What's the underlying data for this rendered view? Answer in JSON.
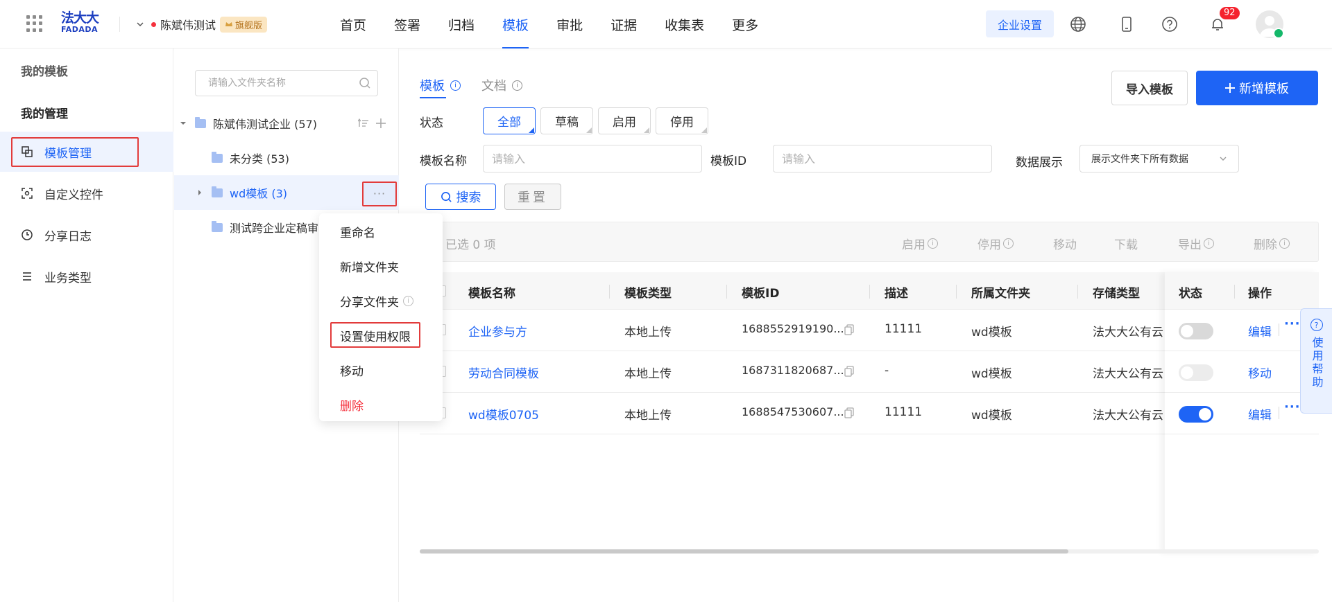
{
  "brand": {
    "logo_cn": "法大大",
    "logo_en": "FADADA"
  },
  "header": {
    "org_name": "陈斌伟测试",
    "edition": "旗舰版",
    "nav": [
      "首页",
      "签署",
      "归档",
      "模板",
      "审批",
      "证据",
      "收集表",
      "更多"
    ],
    "active_nav": "模板",
    "enterprise_settings": "企业设置",
    "notification_count": "92",
    "icons": [
      "apps-grid-icon",
      "globe-icon",
      "mobile-icon",
      "help-icon",
      "bell-icon"
    ]
  },
  "sidebar": {
    "my_templates": "我的模板",
    "my_management": "我的管理",
    "items": [
      {
        "label": "模板管理",
        "icon": "template-manage-icon",
        "active": true
      },
      {
        "label": "自定义控件",
        "icon": "custom-control-icon",
        "active": false
      },
      {
        "label": "分享日志",
        "icon": "clock-icon",
        "active": false
      },
      {
        "label": "业务类型",
        "icon": "list-icon",
        "active": false
      }
    ]
  },
  "folders": {
    "search_placeholder": "请输入文件夹名称",
    "root": "陈斌伟测试企业 (57)",
    "children": [
      {
        "label": "未分类 (53)"
      },
      {
        "label": "wd模板 (3)",
        "selected": true
      },
      {
        "label": "测试跨企业定稿审"
      }
    ]
  },
  "context_menu": {
    "items": [
      "重命名",
      "新增文件夹",
      "分享文件夹",
      "设置使用权限",
      "移动",
      "删除"
    ]
  },
  "main": {
    "tabs": [
      "模板",
      "文档"
    ],
    "import_button": "导入模板",
    "add_button": "新增模板",
    "status_label": "状态",
    "status_options": [
      "全部",
      "草稿",
      "启用",
      "停用"
    ],
    "template_name_label": "模板名称",
    "template_name_placeholder": "请输入",
    "template_id_label": "模板ID",
    "template_id_placeholder": "请输入",
    "data_display_label": "数据展示",
    "data_display_value": "展示文件夹下所有数据",
    "search_button": "搜索",
    "reset_button": "重置",
    "batch": {
      "selected": "已选 0 项",
      "actions": [
        "启用",
        "停用",
        "移动",
        "下载",
        "导出",
        "删除"
      ]
    },
    "table": {
      "columns": [
        "模板名称",
        "模板类型",
        "模板ID",
        "描述",
        "所属文件夹",
        "存储类型",
        "状态",
        "操作"
      ],
      "rows": [
        {
          "name": "企业参与方",
          "type": "本地上传",
          "id": "1688552919190...",
          "desc": "11111",
          "folder": "wd模板",
          "storage": "法大大公有云",
          "enabled": false,
          "op": "编辑",
          "more": "···"
        },
        {
          "name": "劳动合同模板",
          "type": "本地上传",
          "id": "1687311820687...",
          "desc": "-",
          "folder": "wd模板",
          "storage": "法大大公有云",
          "enabled": false,
          "op": "移动",
          "more": ""
        },
        {
          "name": "wd模板0705",
          "type": "本地上传",
          "id": "1688547530607...",
          "desc": "11111",
          "folder": "wd模板",
          "storage": "法大大公有云",
          "enabled": true,
          "op": "编辑",
          "more": "···"
        }
      ]
    }
  },
  "help_tab": "使用帮助",
  "colors": {
    "primary": "#1e64f5",
    "danger": "#f5313d",
    "highlight_box": "#e23b3b"
  }
}
